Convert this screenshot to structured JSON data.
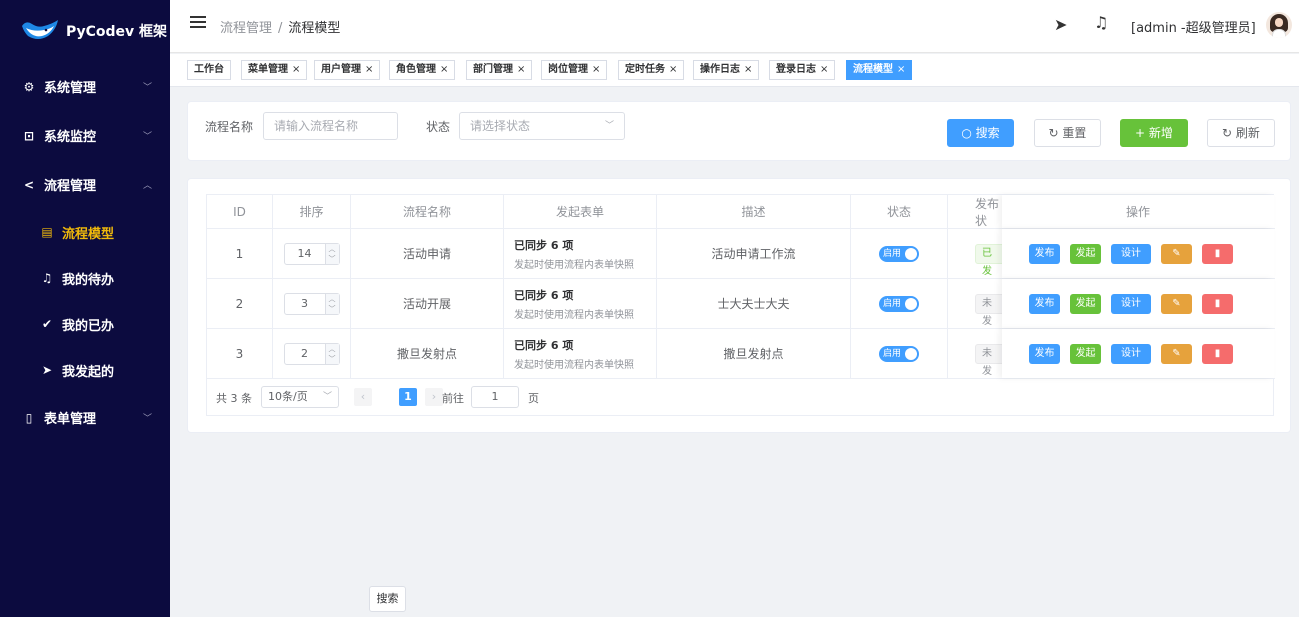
{
  "app": {
    "logo_text": "PyCodev 框架"
  },
  "sidebar": {
    "menus": [
      {
        "label": "系统管理",
        "icon": "gear-icon",
        "chevron": "﹀"
      },
      {
        "label": "系统监控",
        "icon": "monitor-icon",
        "chevron": "﹀"
      },
      {
        "label": "流程管理",
        "icon": "share-icon",
        "chevron": "︿"
      },
      {
        "label": "表单管理",
        "icon": "form-icon",
        "chevron": "﹀"
      }
    ],
    "sub_items": [
      {
        "label": "流程模型",
        "icon": "document-icon",
        "glyph": "▤"
      },
      {
        "label": "我的待办",
        "icon": "bell-icon",
        "glyph": "🔔"
      },
      {
        "label": "我的已办",
        "icon": "check-icon",
        "glyph": "✔"
      },
      {
        "label": "我发起的",
        "icon": "send-icon",
        "glyph": "➤"
      }
    ]
  },
  "header": {
    "breadcrumb": [
      "流程管理",
      "流程模型"
    ],
    "breadcrumb_sep": "/",
    "user_label": "[admin -超级管理员]"
  },
  "tags": [
    {
      "label": "工作台",
      "closable": false
    },
    {
      "label": "菜单管理",
      "closable": true
    },
    {
      "label": "用户管理",
      "closable": true
    },
    {
      "label": "角色管理",
      "closable": true
    },
    {
      "label": "部门管理",
      "closable": true
    },
    {
      "label": "岗位管理",
      "closable": true
    },
    {
      "label": "定时任务",
      "closable": true
    },
    {
      "label": "操作日志",
      "closable": true
    },
    {
      "label": "登录日志",
      "closable": true
    },
    {
      "label": "流程模型",
      "closable": true,
      "active": true
    }
  ],
  "search": {
    "name_label": "流程名称",
    "name_placeholder": "请输入流程名称",
    "status_label": "状态",
    "status_placeholder": "请选择状态",
    "search_btn": "搜索",
    "reset_btn": "重置",
    "add_btn": "新增",
    "refresh_btn": "刷新"
  },
  "table": {
    "columns": [
      "ID",
      "排序",
      "流程名称",
      "发起表单",
      "描述",
      "状态",
      "发布状",
      "操作"
    ],
    "rows": [
      {
        "id": "1",
        "sort": "14",
        "name": "活动申请",
        "form_title": "已同步 6 项",
        "form_sub": "发起时使用流程内表单快照",
        "desc": "活动申请工作流",
        "status": "启用",
        "publish": "已发",
        "published": true
      },
      {
        "id": "2",
        "sort": "3",
        "name": "活动开展",
        "form_title": "已同步 6 项",
        "form_sub": "发起时使用流程内表单快照",
        "desc": "士大夫士大夫",
        "status": "启用",
        "publish": "未发",
        "published": false
      },
      {
        "id": "3",
        "sort": "2",
        "name": "撒旦发射点",
        "form_title": "已同步 6 项",
        "form_sub": "发起时使用流程内表单快照",
        "desc": "撒旦发射点",
        "status": "启用",
        "publish": "未发",
        "published": false
      }
    ],
    "ops": {
      "publish": "发布",
      "start": "发起",
      "design": "设计"
    }
  },
  "pager": {
    "total": "共 3 条",
    "page_size": "10条/页",
    "current": "1",
    "goto_label": "前往",
    "goto_value": "1",
    "page_unit": "页"
  },
  "floating": {
    "search_btn": "搜索"
  },
  "colors": {
    "primary": "#409eff",
    "success": "#67c23a",
    "warning": "#e6a23c",
    "danger": "#f56c6c",
    "sidebar_bg": "#0c0b3f",
    "active_menu": "#f0b90b"
  }
}
